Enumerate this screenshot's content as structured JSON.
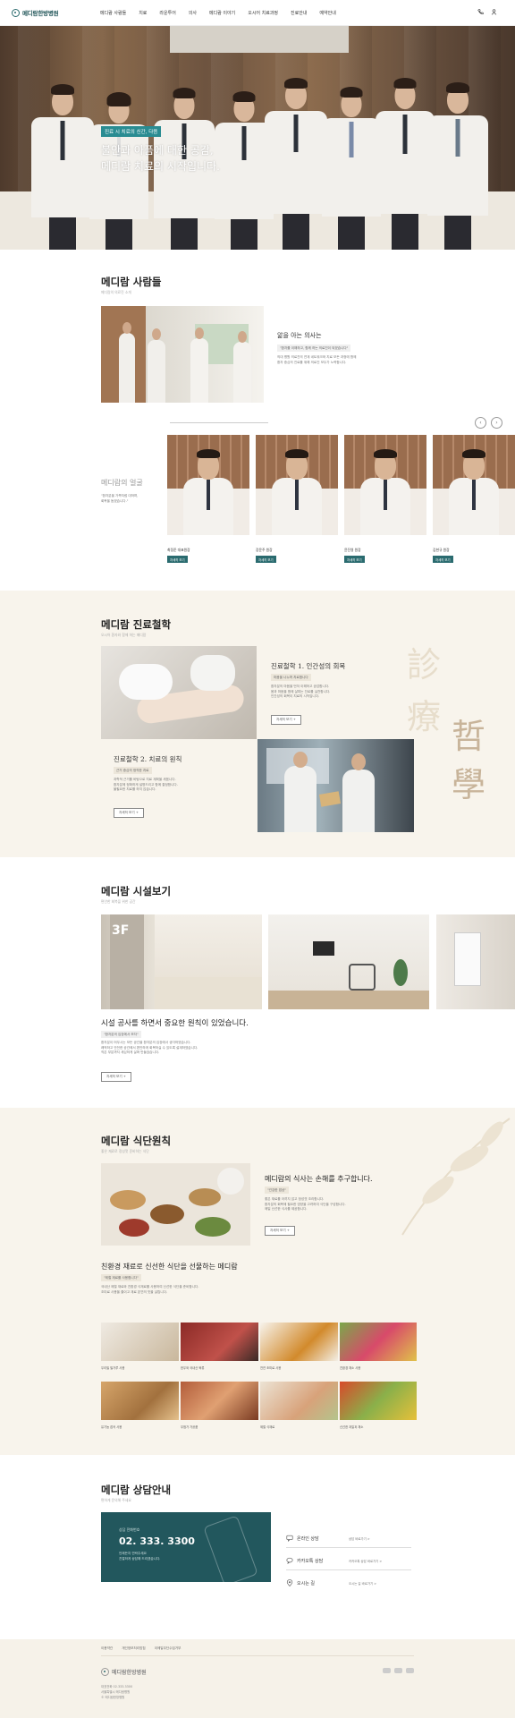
{
  "brand": {
    "name": "메디람한방병원",
    "primary": "#2b6b6e",
    "hero_tag_color": "#2a8c92",
    "beige": "#f8f4ec"
  },
  "header": {
    "nav": [
      "메디람 사람들",
      "치료",
      "라운투어",
      "의사",
      "메디람 이야기",
      "오시어 치료과정",
      "진료안내",
      "예약안내"
    ],
    "icons": [
      "phone-icon",
      "user-icon"
    ]
  },
  "hero": {
    "tag": "진료 시 치료의 신간, 다뜸",
    "title_line1": "불안과 아픔에 대한 공감,",
    "title_line2": "메디람 치료의 시작입니다."
  },
  "people": {
    "title": "메디람 사람들",
    "sub": "메디람의 의료진 소개",
    "feature_title": "앎을 아는 의사는",
    "feature_pill": "\"환자를 이해하고, 함께 하는 의료진이 되겠습니다\"",
    "feature_body1": "의대 병원 의료진의 연계 네트워크와 치료 모든 과정에 함께",
    "feature_body2": "환자 중심의 진료를 위해 의료진 모두가 노력합니다.",
    "group_title": "메디람의 얼굴",
    "group_body1": "\"환자분을 가족처럼 대하며,",
    "group_body2": "회복을 돕겠습니다.\"",
    "doctors": [
      {
        "name": "최정준 대표원장",
        "role": "원장",
        "tag": "자세히 보기"
      },
      {
        "name": "장윤주 원장",
        "role": "원장",
        "tag": "자세히 보기"
      },
      {
        "name": "윤진영 원장",
        "role": "원장",
        "tag": "자세히 보기"
      },
      {
        "name": "김현규 원장",
        "role": "원장",
        "tag": "자세히 보기"
      }
    ]
  },
  "philosophy": {
    "title": "메디람 진료철학",
    "sub": "오시어 환자와 함께 하는 메디람",
    "p1_title": "진료철학 1. 인간성의 회복",
    "p1_pill": "마음을 나누며 치료합니다",
    "p1_body1": "환자분의 마음을 먼저 이해하고 공감합니다.",
    "p1_body2": "몸과 마음을 함께 살피는 진료를 실천합니다.",
    "p1_body3": "인간성의 회복이 치료의 시작입니다.",
    "p1_btn": "자세히 보기 +",
    "p2_title": "진료철학 2. 치료의 원칙",
    "p2_pill": "근거 중심의 정직한 치료",
    "p2_body1": "과학적 근거를 바탕으로 치료 계획을 세웁니다.",
    "p2_body2": "환자분께 정확하게 설명드리고 함께 결정합니다.",
    "p2_body3": "불필요한 치료를 하지 않습니다.",
    "p2_btn": "자세히 보기 +",
    "hanja1": "診",
    "hanja2": "療",
    "hanja3": "哲",
    "hanja4": "學"
  },
  "facility": {
    "title": "메디람 시설보기",
    "sub": "편안한 회복을 위한 공간",
    "sign": "3F",
    "heading": "시설 공사를 하면서 중요한 원칙이 있었습니다.",
    "pill": "\"환자분의 입장에서 보자\"",
    "body1": "환자분이 머무시는 모든 공간을 환자분의 입장에서 생각하였습니다.",
    "body2": "쾌적하고 안전한 공간에서 편안하게 회복하실 수 있도록 설계하였습니다.",
    "body3": "작은 부분까지 세심하게 살펴 만들었습니다.",
    "btn": "자세히 보기 +"
  },
  "meal": {
    "title": "메디람 식단원칙",
    "sub": "좋은 재료로 정성껏 준비하는 식단",
    "feature_title": "메디람의 식사는 손해를 추구합니다.",
    "feature_pill": "\"건강한 밥상\"",
    "feature_body1": "좋은 재료를 아끼지 않고 정성껏 조리합니다.",
    "feature_body2": "환자분의 회복에 필요한 영양을 고려하여 식단을 구성합니다.",
    "feature_body3": "매일 신선한 식사를 제공합니다.",
    "feature_btn": "자세히 보기 +",
    "heading2": "친환경 재료로 신선한 식단을 선물하는 메디람",
    "pill2": "\"제철 재료를 사용합니다\"",
    "body2a": "국내산 제철 재료와 친환경 식재료를 사용하여 신선한 식단을 준비합니다.",
    "body2b": "조미료 사용을 줄이고 재료 본연의 맛을 살립니다.",
    "foods": [
      {
        "caption": "우리밀 밀가루 사용"
      },
      {
        "caption": "한우와 국내산 육류"
      },
      {
        "caption": "천연 조미료 사용"
      },
      {
        "caption": "친환경 채소 사용"
      },
      {
        "caption": "유기농 잡곡 사용"
      },
      {
        "caption": "무첨가 가공품"
      },
      {
        "caption": "제철 식재료"
      },
      {
        "caption": "신선한 과일과 채소"
      }
    ]
  },
  "consult": {
    "title": "메디람 상담안내",
    "sub": "편하게 문의해 주세요",
    "label": "상담 전화번호",
    "phone": "02. 333. 3300",
    "note1": "언제든지 연락주세요",
    "note2": "친절하게 상담해 드리겠습니다.",
    "rows": [
      {
        "icon": "chat-icon",
        "label": "온라인 상담",
        "detail": "상담 바로가기 >"
      },
      {
        "icon": "kakao-icon",
        "label": "카카오톡 상담",
        "detail": "카카오톡 상담 바로가기 >"
      },
      {
        "icon": "map-pin-icon",
        "label": "오시는 길",
        "detail": "오시는 길 바로가기 >"
      }
    ]
  },
  "footer": {
    "links": [
      "이용약관",
      "개인정보처리방침",
      "이메일무단수집거부"
    ],
    "logo": "메디람한방병원",
    "info1": "대표전화 02.333.3300",
    "info2": "서울특별시 메디람병원",
    "copyright": "© 메디람한방병원"
  }
}
